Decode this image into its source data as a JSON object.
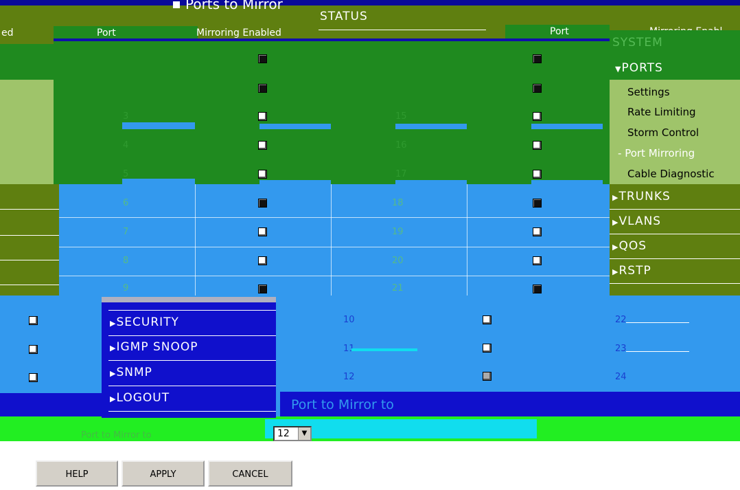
{
  "header": {
    "page_title": "Ports to Mirror",
    "status_label": "STATUS",
    "left_col_partial": "ed",
    "col_port_left": "Port",
    "col_mirroring_left": "Mirroring Enabled",
    "col_port_right": "Port",
    "col_mirroring_right": "Mirroring Enabl"
  },
  "sidebar": {
    "system": "SYSTEM",
    "ports": "PORTS",
    "sub_items": [
      "Settings",
      "Rate Limiting",
      "Storm Control",
      "Port Mirroring",
      "Cable Diagnostic"
    ],
    "trunks": "TRUNKS",
    "vlans": "VLANS",
    "qos": "QOS",
    "rstp": "RSTP"
  },
  "menu": {
    "security": "SECURITY",
    "igmp": "IGMP SNOOP",
    "snmp": "SNMP",
    "logout": "LOGOUT"
  },
  "ports_left": [
    "3",
    "4",
    "5",
    "6",
    "7",
    "8",
    "9"
  ],
  "ports_right": [
    "15",
    "16",
    "17",
    "18",
    "19",
    "20",
    "21"
  ],
  "ports_lower_mid": [
    "10",
    "11",
    "12"
  ],
  "ports_lower_right": [
    "22",
    "23",
    "24"
  ],
  "mirror": {
    "label_blue": "Port to Mirror to",
    "label_green": "Port to Mirror to",
    "selected_value": "12"
  },
  "buttons": {
    "help": "HELP",
    "apply": "APPLY",
    "cancel": "CANCEL"
  },
  "colors": {
    "green": "#1f8a1f",
    "olive": "#5f7f10",
    "blue": "#3399ee",
    "navy": "#1010cc",
    "lime": "#22ee22"
  }
}
